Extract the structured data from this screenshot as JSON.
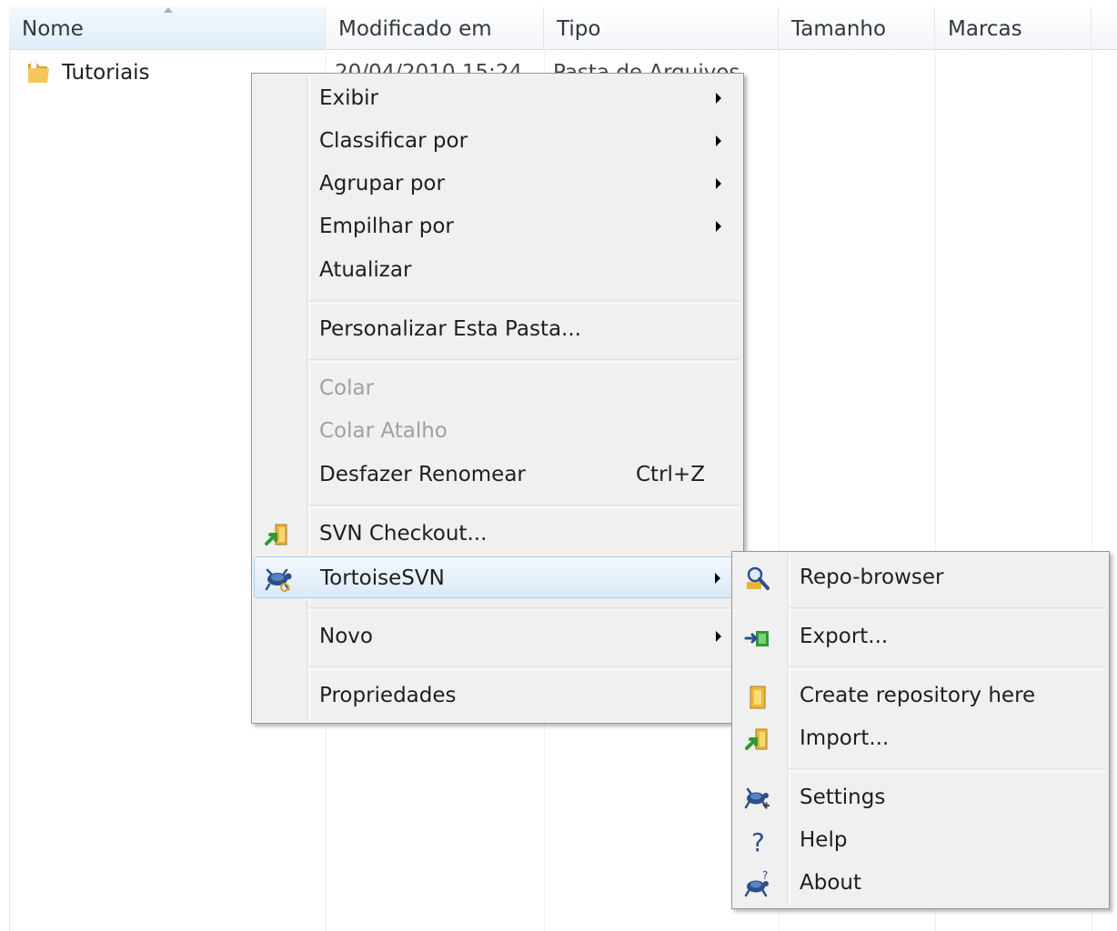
{
  "columns": {
    "name": "Nome",
    "modified": "Modificado em",
    "type": "Tipo",
    "size": "Tamanho",
    "tags": "Marcas"
  },
  "files": [
    {
      "name": "Tutoriais",
      "date": "20/04/2010 15:24",
      "type": "Pasta de Arquivos",
      "icon": "folder-icon"
    }
  ],
  "context_menu": {
    "items": [
      {
        "label": "Exibir",
        "submenu": true
      },
      {
        "label": "Classificar por",
        "submenu": true
      },
      {
        "label": "Agrupar por",
        "submenu": true
      },
      {
        "label": "Empilhar por",
        "submenu": true
      },
      {
        "label": "Atualizar"
      },
      {
        "label": "Personalizar Esta Pasta..."
      },
      {
        "label": "Colar",
        "disabled": true
      },
      {
        "label": "Colar Atalho",
        "disabled": true
      },
      {
        "label": "Desfazer Renomear",
        "shortcut": "Ctrl+Z"
      },
      {
        "label": "SVN Checkout...",
        "icon": "svn-checkout-icon"
      },
      {
        "label": "TortoiseSVN",
        "icon": "tortoisesvn-icon",
        "submenu": true,
        "highlighted": true
      },
      {
        "label": "Novo",
        "submenu": true
      },
      {
        "label": "Propriedades"
      }
    ]
  },
  "tortoise_submenu": {
    "items": [
      {
        "label": "Repo-browser",
        "icon": "repo-browser-icon"
      },
      {
        "label": "Export...",
        "icon": "export-icon"
      },
      {
        "label": "Create repository here",
        "icon": "create-repository-icon"
      },
      {
        "label": "Import...",
        "icon": "import-icon"
      },
      {
        "label": "Settings",
        "icon": "settings-icon"
      },
      {
        "label": "Help",
        "icon": "help-icon"
      },
      {
        "label": "About",
        "icon": "about-icon"
      }
    ]
  },
  "colors": {
    "highlight_border": "#a8d1f0",
    "menu_background": "#f0f0f0",
    "disabled_text": "#a0a0a0"
  }
}
